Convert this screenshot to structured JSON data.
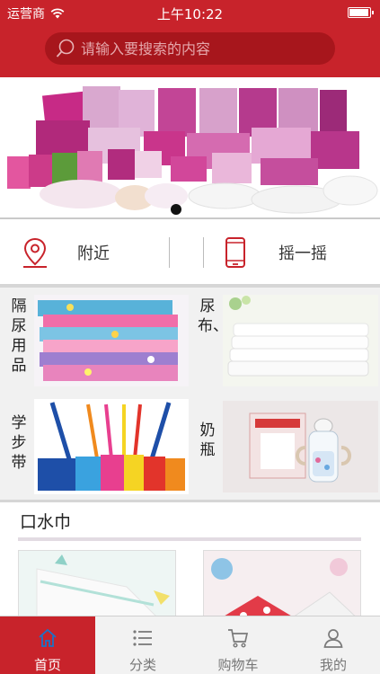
{
  "statusbar": {
    "carrier": "运营商",
    "time": "上午10:22",
    "battery_level": 0.95
  },
  "search": {
    "placeholder": "请输入要搜索的内容"
  },
  "banner": {
    "page_count": 1,
    "active_page": 1
  },
  "actions": {
    "nearby_label": "附近",
    "shake_label": "摇一摇",
    "nearby_icon": "location-pin-icon",
    "shake_icon": "phone-icon"
  },
  "categories": [
    {
      "label": "隔尿用品",
      "image": "changing-pad-image"
    },
    {
      "label": "尿布、…",
      "image": "cloth-diaper-image"
    },
    {
      "label": "学步带",
      "image": "walking-harness-image"
    },
    {
      "label": "奶瓶",
      "image": "baby-bottle-image"
    }
  ],
  "section": {
    "title": "口水巾"
  },
  "tabs": [
    {
      "label": "首页",
      "icon": "home-icon",
      "active": true
    },
    {
      "label": "分类",
      "icon": "list-icon",
      "active": false
    },
    {
      "label": "购物车",
      "icon": "cart-icon",
      "active": false
    },
    {
      "label": "我的",
      "icon": "user-icon",
      "active": false
    }
  ],
  "colors": {
    "brand_red": "#c8232b",
    "search_bg": "#a7161c",
    "tab_inactive": "#777777"
  }
}
